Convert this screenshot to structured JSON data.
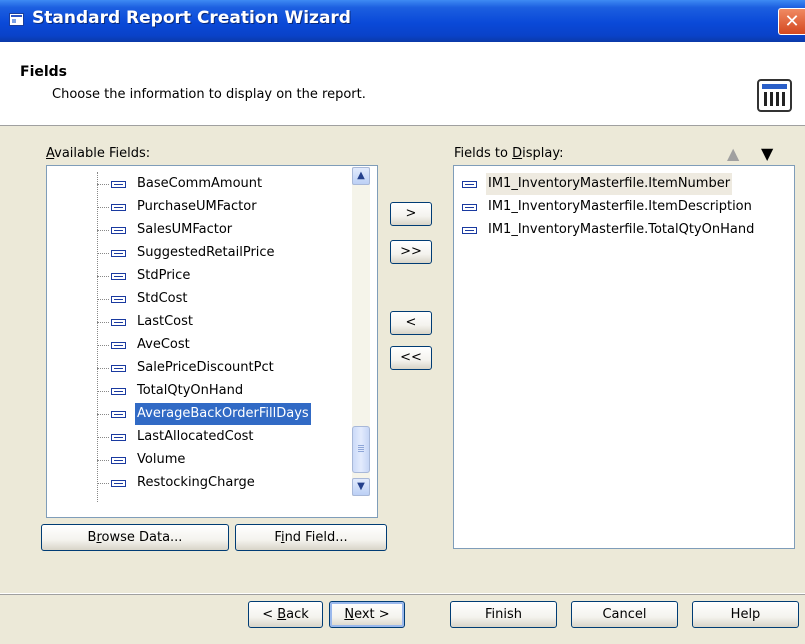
{
  "window": {
    "title": "Standard Report Creation Wizard",
    "close_glyph": "✕"
  },
  "header": {
    "title": "Fields",
    "subtitle": "Choose the information to display on the report.",
    "icon": "report-table-icon"
  },
  "available": {
    "label_pre": "",
    "label_u": "A",
    "label_post": "vailable Fields:",
    "items": [
      "BaseCommAmount",
      "PurchaseUMFactor",
      "SalesUMFactor",
      "SuggestedRetailPrice",
      "StdPrice",
      "StdCost",
      "LastCost",
      "AveCost",
      "SalePriceDiscountPct",
      "TotalQtyOnHand",
      "AverageBackOrderFillDays",
      "LastAllocatedCost",
      "Volume",
      "RestockingCharge"
    ],
    "selected": "AverageBackOrderFillDays"
  },
  "display": {
    "label_pre": "Fields to ",
    "label_u": "D",
    "label_post": "isplay:",
    "items": [
      "IM1_InventoryMasterfile.ItemNumber",
      "IM1_InventoryMasterfile.ItemDescription",
      "IM1_InventoryMasterfile.TotalQtyOnHand"
    ]
  },
  "transfer": {
    "add": ">",
    "add_all": ">>",
    "remove": "<",
    "remove_all": "<<"
  },
  "scrollbar": {
    "up": "▲",
    "down": "▼"
  },
  "sort": {
    "up": "▲",
    "down": "▼",
    "up_color": "#a0a0a0",
    "down_color": "#000000"
  },
  "buttons": {
    "browse_pre": "B",
    "browse_u": "r",
    "browse_post": "owse Data...",
    "find_pre": "F",
    "find_u": "i",
    "find_post": "nd Field..."
  },
  "footer": {
    "back_pre": "< ",
    "back_u": "B",
    "back_post": "ack",
    "next_pre": "",
    "next_u": "N",
    "next_post": "ext >",
    "finish": "Finish",
    "cancel": "Cancel",
    "help": "Help"
  }
}
